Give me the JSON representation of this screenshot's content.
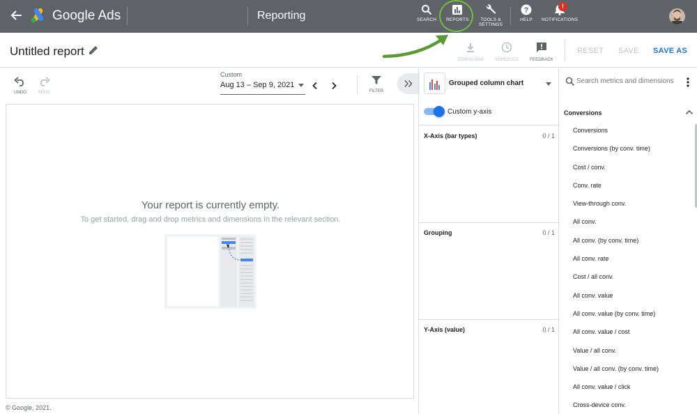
{
  "topbar": {
    "brand": "Google Ads",
    "page_heading": "Reporting",
    "tools": [
      {
        "label": "SEARCH",
        "icon": "search-icon"
      },
      {
        "label": "REPORTS",
        "icon": "bar-chart-icon"
      },
      {
        "label_line1": "TOOLS &",
        "label_line2": "SETTINGS",
        "icon": "wrench-icon"
      },
      {
        "label": "HELP",
        "icon": "help-icon"
      },
      {
        "label": "NOTIFICATIONS",
        "icon": "bell-icon",
        "badge": "!"
      }
    ]
  },
  "titlebar": {
    "title": "Untitled report",
    "actions": [
      {
        "label": "DOWNLOAD",
        "icon": "download-icon"
      },
      {
        "label": "SCHEDULE",
        "icon": "clock-icon"
      },
      {
        "label": "FEEDBACK",
        "icon": "feedback-icon"
      }
    ],
    "reset": "RESET",
    "save": "SAVE",
    "save_as": "SAVE AS"
  },
  "controls": {
    "undo": "UNDO",
    "redo": "REDO",
    "date_caption": "Custom",
    "date_range": "Aug 13 – Sep 9, 2021",
    "filter": "FILTER"
  },
  "canvas": {
    "empty_title": "Your report is currently empty.",
    "empty_subtitle": "To get started, drag and drop metrics and dimensions in the relevant section."
  },
  "footer": "© Google, 2021.",
  "chart_config": {
    "chart_type": "Grouped column chart",
    "toggle_label": "Custom y-axis",
    "toggle_on": true,
    "sections": [
      {
        "title": "X-Axis (bar types)",
        "count": "0 / 1"
      },
      {
        "title": "Grouping",
        "count": "0 / 1"
      },
      {
        "title": "Y-Axis (value)",
        "count": "0 / 1"
      }
    ]
  },
  "metrics": {
    "search_placeholder": "Search metrics and dimensions",
    "group_title": "Conversions",
    "items": [
      "Conversions",
      "Conversions (by conv. time)",
      "Cost / conv.",
      "Conv. rate",
      "View-through conv.",
      "All conv.",
      "All conv. (by conv. time)",
      "All conv. rate",
      "Cost / all conv.",
      "All conv. value",
      "All conv. value (by conv. time)",
      "All conv. value / cost",
      "Value / all conv.",
      "Value / all conv. (by conv. time)",
      "All conv. value / click",
      "Cross-device conv."
    ]
  },
  "colors": {
    "topbar_bg": "#5f6368",
    "accent_blue": "#1a73e8",
    "annotation_green": "#5a9a32"
  }
}
